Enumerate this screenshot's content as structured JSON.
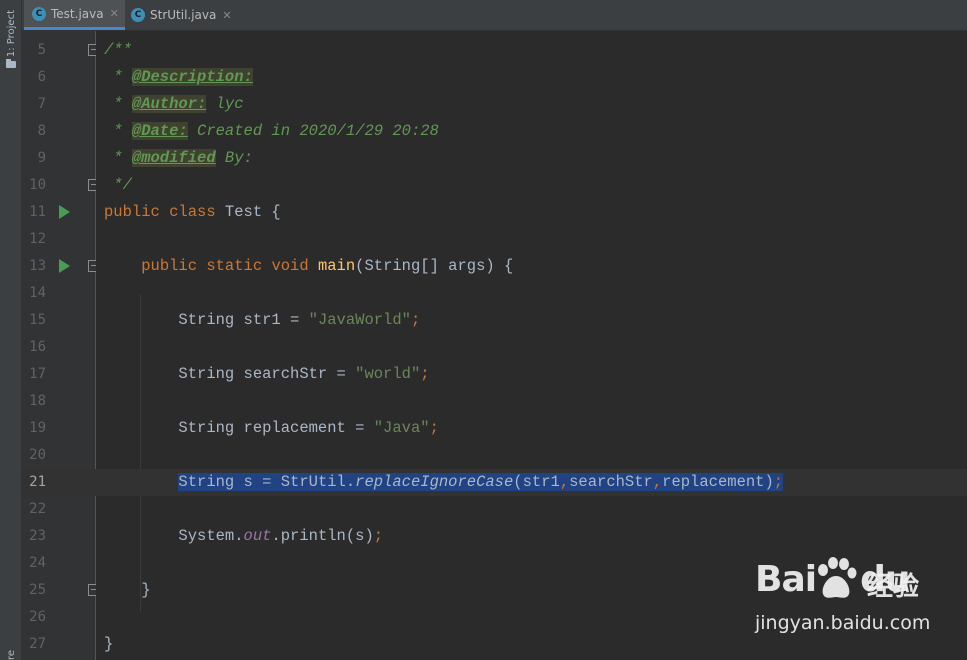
{
  "toolstrip": {
    "project_label": "1: Project",
    "structure_label": "re"
  },
  "tabs": [
    {
      "label": "Test.java",
      "icon": "java-class-icon",
      "active": true
    },
    {
      "label": "StrUtil.java",
      "icon": "java-class-icon",
      "active": false
    }
  ],
  "editor": {
    "current_line": 21,
    "lines": [
      {
        "no": "5",
        "fold": true,
        "run": false,
        "segments": [
          {
            "cls": "doc",
            "t": "/**"
          }
        ]
      },
      {
        "no": "6",
        "segments": [
          {
            "cls": "doc",
            "t": " * "
          },
          {
            "cls": "doctag",
            "t": "@Description:"
          }
        ]
      },
      {
        "no": "7",
        "segments": [
          {
            "cls": "doc",
            "t": " * "
          },
          {
            "cls": "doctag",
            "t": "@Author:"
          },
          {
            "cls": "doc",
            "t": " lyc"
          }
        ]
      },
      {
        "no": "8",
        "segments": [
          {
            "cls": "doc",
            "t": " * "
          },
          {
            "cls": "doctag",
            "t": "@Date:"
          },
          {
            "cls": "doc",
            "t": " Created in 2020/1/29 20:28"
          }
        ]
      },
      {
        "no": "9",
        "segments": [
          {
            "cls": "doc",
            "t": " * "
          },
          {
            "cls": "doctag",
            "t": "@modified"
          },
          {
            "cls": "doc",
            "t": " By:"
          }
        ]
      },
      {
        "no": "10",
        "fold": true,
        "segments": [
          {
            "cls": "doc",
            "t": " */"
          }
        ]
      },
      {
        "no": "11",
        "run": true,
        "segments": [
          {
            "cls": "kw",
            "t": "public class "
          },
          {
            "cls": "",
            "t": "Test {"
          }
        ]
      },
      {
        "no": "12",
        "segments": []
      },
      {
        "no": "13",
        "run": true,
        "fold": true,
        "segments": [
          {
            "cls": "",
            "t": "    "
          },
          {
            "cls": "kw",
            "t": "public static void "
          },
          {
            "cls": "fn",
            "t": "main"
          },
          {
            "cls": "",
            "t": "(String[] args) {"
          }
        ]
      },
      {
        "no": "14",
        "segments": []
      },
      {
        "no": "15",
        "segments": [
          {
            "cls": "",
            "t": "        String str1 = "
          },
          {
            "cls": "str",
            "t": "\"JavaWorld\""
          },
          {
            "cls": "kw",
            "t": ";"
          }
        ]
      },
      {
        "no": "16",
        "segments": []
      },
      {
        "no": "17",
        "segments": [
          {
            "cls": "",
            "t": "        String searchStr = "
          },
          {
            "cls": "str",
            "t": "\"world\""
          },
          {
            "cls": "kw",
            "t": ";"
          }
        ]
      },
      {
        "no": "18",
        "segments": []
      },
      {
        "no": "19",
        "segments": [
          {
            "cls": "",
            "t": "        String replacement = "
          },
          {
            "cls": "str",
            "t": "\"Java\""
          },
          {
            "cls": "kw",
            "t": ";"
          }
        ]
      },
      {
        "no": "20",
        "segments": []
      },
      {
        "no": "21",
        "bulb": true,
        "selected_from": 8,
        "segments": [
          {
            "cls": "",
            "t": "        "
          },
          {
            "cls": "sel",
            "t": "String s = StrUtil."
          },
          {
            "cls": "sel static-m",
            "t": "replaceIgnoreCase"
          },
          {
            "cls": "sel",
            "t": "(str1"
          },
          {
            "cls": "sel kw",
            "t": ","
          },
          {
            "cls": "sel",
            "t": "searchStr"
          },
          {
            "cls": "sel kw",
            "t": ","
          },
          {
            "cls": "sel",
            "t": "replacement)"
          },
          {
            "cls": "sel kw",
            "t": ";"
          }
        ]
      },
      {
        "no": "22",
        "segments": []
      },
      {
        "no": "23",
        "segments": [
          {
            "cls": "",
            "t": "        System."
          },
          {
            "cls": "field",
            "t": "out"
          },
          {
            "cls": "",
            "t": ".println(s)"
          },
          {
            "cls": "kw",
            "t": ";"
          }
        ]
      },
      {
        "no": "24",
        "segments": []
      },
      {
        "no": "25",
        "fold": true,
        "segments": [
          {
            "cls": "",
            "t": "    }"
          }
        ]
      },
      {
        "no": "26",
        "segments": []
      },
      {
        "no": "27",
        "segments": [
          {
            "cls": "",
            "t": "}"
          }
        ]
      }
    ]
  },
  "watermark": {
    "logo_text": "Bai",
    "logo_text_2": "du",
    "brand_cn": "经验",
    "url": "jingyan.baidu.com"
  }
}
